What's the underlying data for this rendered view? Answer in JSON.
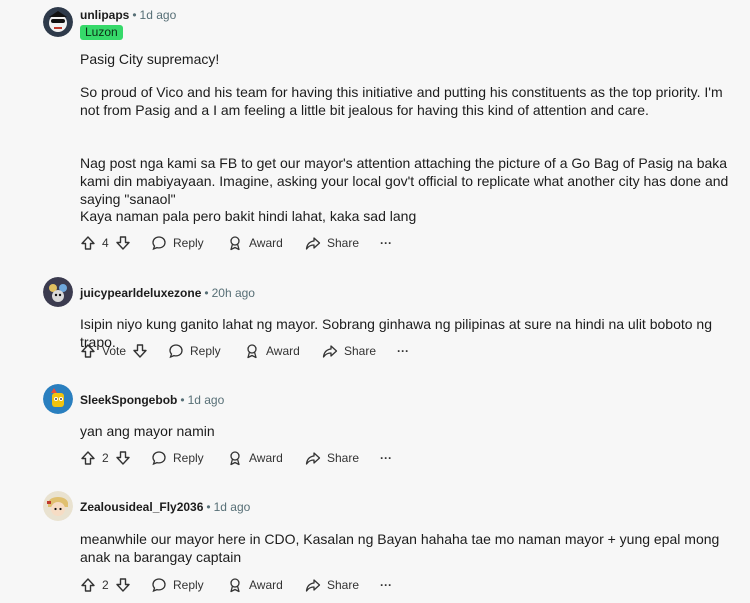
{
  "comments": [
    {
      "username": "unlipaps",
      "time": "1d ago",
      "flair": "Luzon",
      "paragraphs": [
        "Pasig City supremacy!",
        "So proud of Vico and his team for having this initiative and putting his constituents as the top priority. I'm not from Pasig and a I am feeling a little bit jealous for having this kind of attention and care.",
        "Nag post nga kami sa FB to get our mayor's attention attaching the picture of a Go Bag of Pasig na baka kami din mabiyayaan. Imagine, asking your local gov't official to replicate what another city has done and saying \"sanaol\"",
        "Kaya naman pala pero bakit hindi lahat, kaka sad lang"
      ],
      "votes": "4",
      "reply": "Reply",
      "award": "Award",
      "share": "Share",
      "more": "···"
    },
    {
      "username": "juicypearldeluxezone",
      "time": "20h ago",
      "paragraphs": [
        "Isipin niyo kung ganito lahat ng mayor. Sobrang ginhawa ng pilipinas at sure na hindi na ulit boboto ng trapo."
      ],
      "votes": "Vote",
      "reply": "Reply",
      "award": "Award",
      "share": "Share",
      "more": "···"
    },
    {
      "username": "SleekSpongebob",
      "time": "1d ago",
      "paragraphs": [
        "yan ang mayor namin"
      ],
      "votes": "2",
      "reply": "Reply",
      "award": "Award",
      "share": "Share",
      "more": "···"
    },
    {
      "username": "Zealousideal_Fly2036",
      "time": "1d ago",
      "paragraphs": [
        "meanwhile our mayor here in CDO, Kasalan ng Bayan hahaha tae mo naman mayor + yung epal mong anak na barangay captain"
      ],
      "votes": "2",
      "reply": "Reply",
      "award": "Award",
      "share": "Share",
      "more": "···"
    }
  ],
  "colors": {
    "background": "#f7f7f7",
    "flair_bg": "#36d96a",
    "meta_text": "#576f76"
  },
  "icons": [
    "upvote-icon",
    "downvote-icon",
    "reply-bubble-icon",
    "award-icon",
    "share-arrow-icon",
    "more-dots-icon"
  ]
}
